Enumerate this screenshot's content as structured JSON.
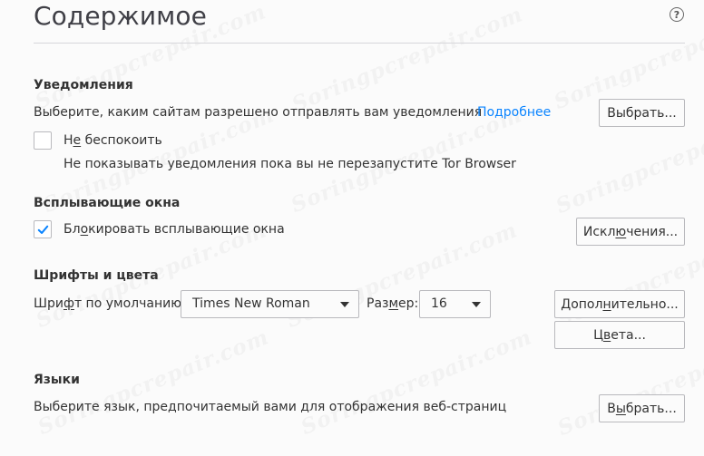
{
  "title": "Содержимое",
  "help": {
    "icon": "help-icon",
    "label": "?"
  },
  "notifications": {
    "heading": "Уведомления",
    "description": "Выберите, каким сайтам разрешено отправлять вам уведомления",
    "learn_more": "Подробнее",
    "choose_button": "Выбрать...",
    "do_not_disturb": {
      "label_prefix": "Н",
      "label_accel": "е",
      "label_suffix": " беспокоить",
      "checked": false
    },
    "do_not_disturb_note": "Не показывать уведомления пока вы не перезапустите Tor Browser"
  },
  "popups": {
    "heading": "Всплывающие окна",
    "block_popups": {
      "label_prefix": "Бл",
      "label_accel": "о",
      "label_suffix": "кировать всплывающие окна",
      "checked": true
    },
    "exceptions_button": {
      "prefix": "Искл",
      "accel": "ю",
      "suffix": "чения..."
    }
  },
  "fonts_colors": {
    "heading": "Шрифты и цвета",
    "default_font_label": {
      "prefix": "Шри",
      "accel": "ф",
      "suffix": "т по умолчанию:"
    },
    "default_font_value": "Times New Roman",
    "size_label": {
      "prefix": "Раз",
      "accel": "м",
      "suffix": "ер:"
    },
    "size_value": "16",
    "advanced_button": {
      "prefix": "Допол",
      "accel": "н",
      "suffix": "ительно..."
    },
    "colors_button": {
      "prefix": "Ц",
      "accel": "в",
      "suffix": "ета..."
    }
  },
  "languages": {
    "heading": "Языки",
    "description": "Выберите язык, предпочитаемый вами для отображения веб-страниц",
    "choose_button": {
      "prefix": "В",
      "accel": "ы",
      "suffix": "брать..."
    }
  },
  "watermark": "Soringpcrepair.com",
  "colors": {
    "background": "#fbfbfb",
    "text": "#333333",
    "link": "#0a84ff",
    "checkmark": "#0a84ff",
    "border": "#b9b9bd",
    "divider": "#d7d7db"
  }
}
